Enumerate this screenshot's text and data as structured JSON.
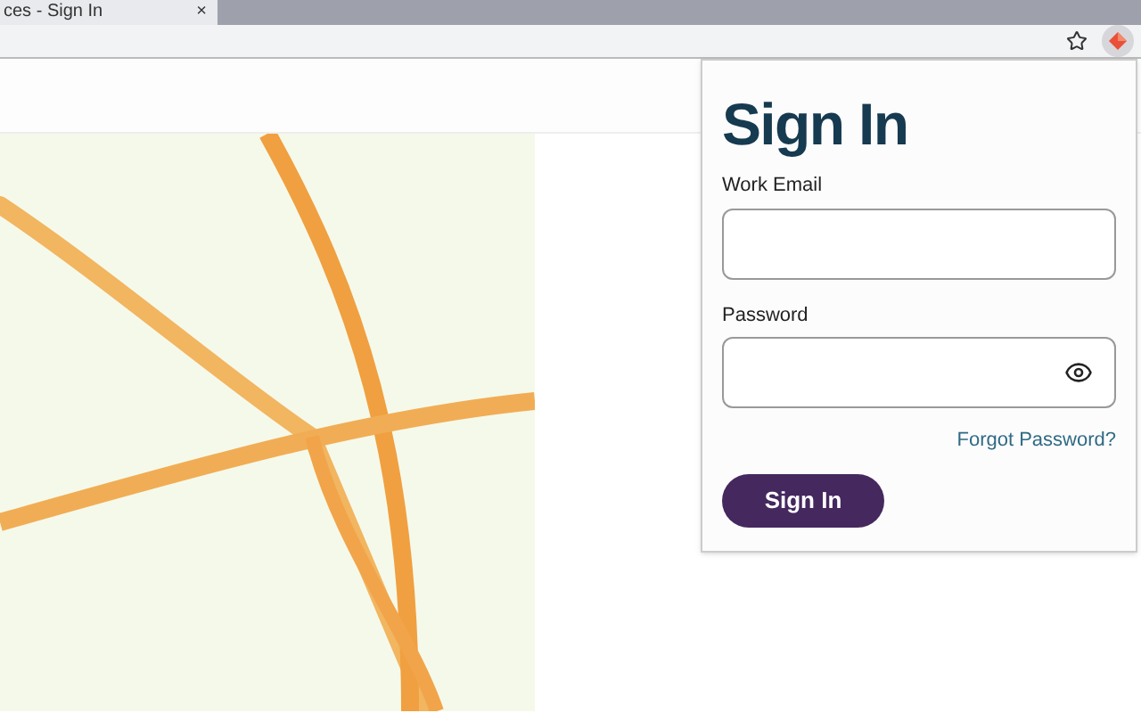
{
  "browser": {
    "tab_title": "ces - Sign In",
    "tab_close": "×"
  },
  "popup": {
    "title": "Sign In",
    "email_label": "Work Email",
    "password_label": "Password",
    "forgot_link": "Forgot Password?",
    "submit": "Sign In"
  }
}
